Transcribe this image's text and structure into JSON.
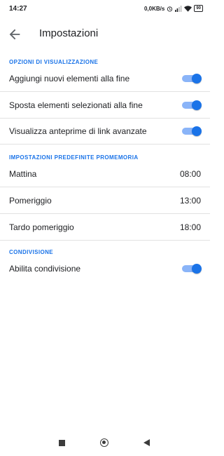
{
  "status_bar": {
    "time": "14:27",
    "network_speed": "0,0KB/s",
    "battery": "90"
  },
  "app_bar": {
    "title": "Impostazioni",
    "back_icon": "arrow-back-icon"
  },
  "display_options": {
    "header": "OPZIONI DI VISUALIZZAZIONE",
    "items": [
      {
        "label": "Aggiungi nuovi elementi alla fine",
        "enabled": true
      },
      {
        "label": "Sposta elementi selezionati alla fine",
        "enabled": true
      },
      {
        "label": "Visualizza anteprime di link avanzate",
        "enabled": true
      }
    ]
  },
  "reminder_defaults": {
    "header": "IMPOSTAZIONI PREDEFINITE PROMEMORIA",
    "items": [
      {
        "label": "Mattina",
        "value": "08:00"
      },
      {
        "label": "Pomeriggio",
        "value": "13:00"
      },
      {
        "label": "Tardo pomeriggio",
        "value": "18:00"
      }
    ]
  },
  "sharing": {
    "header": "CONDIVISIONE",
    "items": [
      {
        "label": "Abilita condivisione",
        "enabled": true
      }
    ]
  },
  "colors": {
    "accent": "#1a73e8",
    "toggle_track": "#8ab4f8",
    "divider": "#e2e2e2"
  },
  "nav_bar": {
    "icons": [
      "recents-square-icon",
      "home-circle-icon",
      "back-triangle-icon"
    ]
  }
}
